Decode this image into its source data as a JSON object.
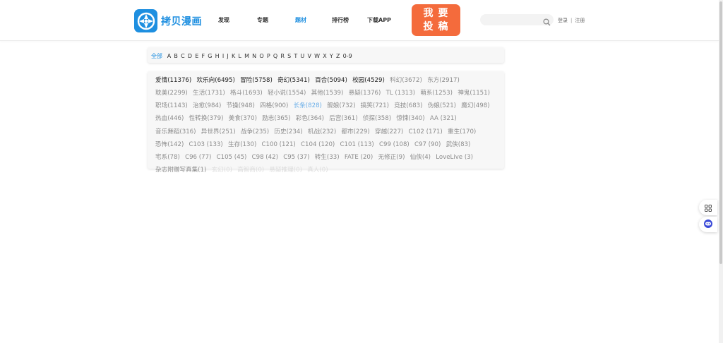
{
  "header": {
    "logo_text": "拷贝漫画",
    "nav": [
      "发现",
      "专题",
      "题材",
      "排行榜",
      "下载APP"
    ],
    "nav_active": 2,
    "submit_line1": "我要",
    "submit_line2": "投稿",
    "search_placeholder": "",
    "login": "登录",
    "separator": "|",
    "register": "注册"
  },
  "letters": {
    "active": "全部",
    "items": [
      "A",
      "B",
      "C",
      "D",
      "E",
      "F",
      "G",
      "H",
      "I",
      "J",
      "K",
      "L",
      "M",
      "N",
      "O",
      "P",
      "Q",
      "R",
      "S",
      "T",
      "U",
      "V",
      "W",
      "X",
      "Y",
      "Z",
      "0-9"
    ]
  },
  "colors": {
    "brand": "#1e8fe0",
    "submit": "#f46b3c",
    "tag_popular": "#222222",
    "tag_normal": "#8c8c8c",
    "tag_highlight": "#6aaee8",
    "tag_faded": "#dcdcdc"
  },
  "tags": [
    {
      "label": "爱情(11376)",
      "style": 0
    },
    {
      "label": "欢乐向(6495)",
      "style": 0
    },
    {
      "label": "冒险(5758)",
      "style": 0
    },
    {
      "label": "奇幻(5341)",
      "style": 0
    },
    {
      "label": "百合(5094)",
      "style": 0
    },
    {
      "label": "校园(4529)",
      "style": 0
    },
    {
      "label": "科幻(3672)",
      "style": 1
    },
    {
      "label": "东方(2917)",
      "style": 1
    },
    {
      "label": "耽美(2299)",
      "style": 1
    },
    {
      "label": "生活(1731)",
      "style": 1
    },
    {
      "label": "格斗(1693)",
      "style": 1
    },
    {
      "label": "轻小说(1554)",
      "style": 1
    },
    {
      "label": "其他(1539)",
      "style": 1
    },
    {
      "label": "悬疑(1376)",
      "style": 1
    },
    {
      "label": "TL (1313)",
      "style": 1
    },
    {
      "label": "萌系(1253)",
      "style": 1
    },
    {
      "label": "神鬼(1151)",
      "style": 1
    },
    {
      "label": "职场(1143)",
      "style": 1
    },
    {
      "label": "治愈(984)",
      "style": 1
    },
    {
      "label": "节操(948)",
      "style": 1
    },
    {
      "label": "四格(900)",
      "style": 1
    },
    {
      "label": "长条(828)",
      "style": 2
    },
    {
      "label": "舰娘(732)",
      "style": 1
    },
    {
      "label": "搞笑(721)",
      "style": 1
    },
    {
      "label": "竞技(683)",
      "style": 1
    },
    {
      "label": "伪娘(521)",
      "style": 1
    },
    {
      "label": "魔幻(498)",
      "style": 1
    },
    {
      "label": "热血(446)",
      "style": 1
    },
    {
      "label": "性转换(379)",
      "style": 1
    },
    {
      "label": "美食(370)",
      "style": 1
    },
    {
      "label": "励志(365)",
      "style": 1
    },
    {
      "label": "彩色(364)",
      "style": 1
    },
    {
      "label": "后宫(361)",
      "style": 1
    },
    {
      "label": "侦探(358)",
      "style": 1
    },
    {
      "label": "惊悚(340)",
      "style": 1
    },
    {
      "label": "AA (321)",
      "style": 1
    },
    {
      "label": "音乐舞蹈(316)",
      "style": 1
    },
    {
      "label": "异世界(251)",
      "style": 1
    },
    {
      "label": "战争(235)",
      "style": 1
    },
    {
      "label": "历史(234)",
      "style": 1
    },
    {
      "label": "机战(232)",
      "style": 1
    },
    {
      "label": "都市(229)",
      "style": 1
    },
    {
      "label": "穿越(227)",
      "style": 1
    },
    {
      "label": "C102 (171)",
      "style": 1
    },
    {
      "label": "重生(170)",
      "style": 1
    },
    {
      "label": "恐怖(142)",
      "style": 1
    },
    {
      "label": "C103 (133)",
      "style": 1
    },
    {
      "label": "生存(130)",
      "style": 1
    },
    {
      "label": "C100 (121)",
      "style": 1
    },
    {
      "label": "C104 (120)",
      "style": 1
    },
    {
      "label": "C101 (113)",
      "style": 1
    },
    {
      "label": "C99 (108)",
      "style": 1
    },
    {
      "label": "C97 (90)",
      "style": 1
    },
    {
      "label": "武侠(83)",
      "style": 1
    },
    {
      "label": "宅系(78)",
      "style": 1
    },
    {
      "label": "C96 (77)",
      "style": 1
    },
    {
      "label": "C105 (45)",
      "style": 1
    },
    {
      "label": "C98 (42)",
      "style": 1
    },
    {
      "label": "C95 (37)",
      "style": 1
    },
    {
      "label": "转生(33)",
      "style": 1
    },
    {
      "label": "FATE (20)",
      "style": 1
    },
    {
      "label": "无修正(9)",
      "style": 1
    },
    {
      "label": "仙侠(4)",
      "style": 1
    },
    {
      "label": "LoveLive (3)",
      "style": 1
    },
    {
      "label": "杂志附赠写真集(1)",
      "style": 1
    },
    {
      "label": "玄幻(0)",
      "style": 3
    },
    {
      "label": "高智商(0)",
      "style": 3
    },
    {
      "label": "悬疑推理(0)",
      "style": 3
    },
    {
      "label": "真人(0)",
      "style": 3
    }
  ],
  "widgets": [
    "grid-icon",
    "chat-bot-icon"
  ]
}
